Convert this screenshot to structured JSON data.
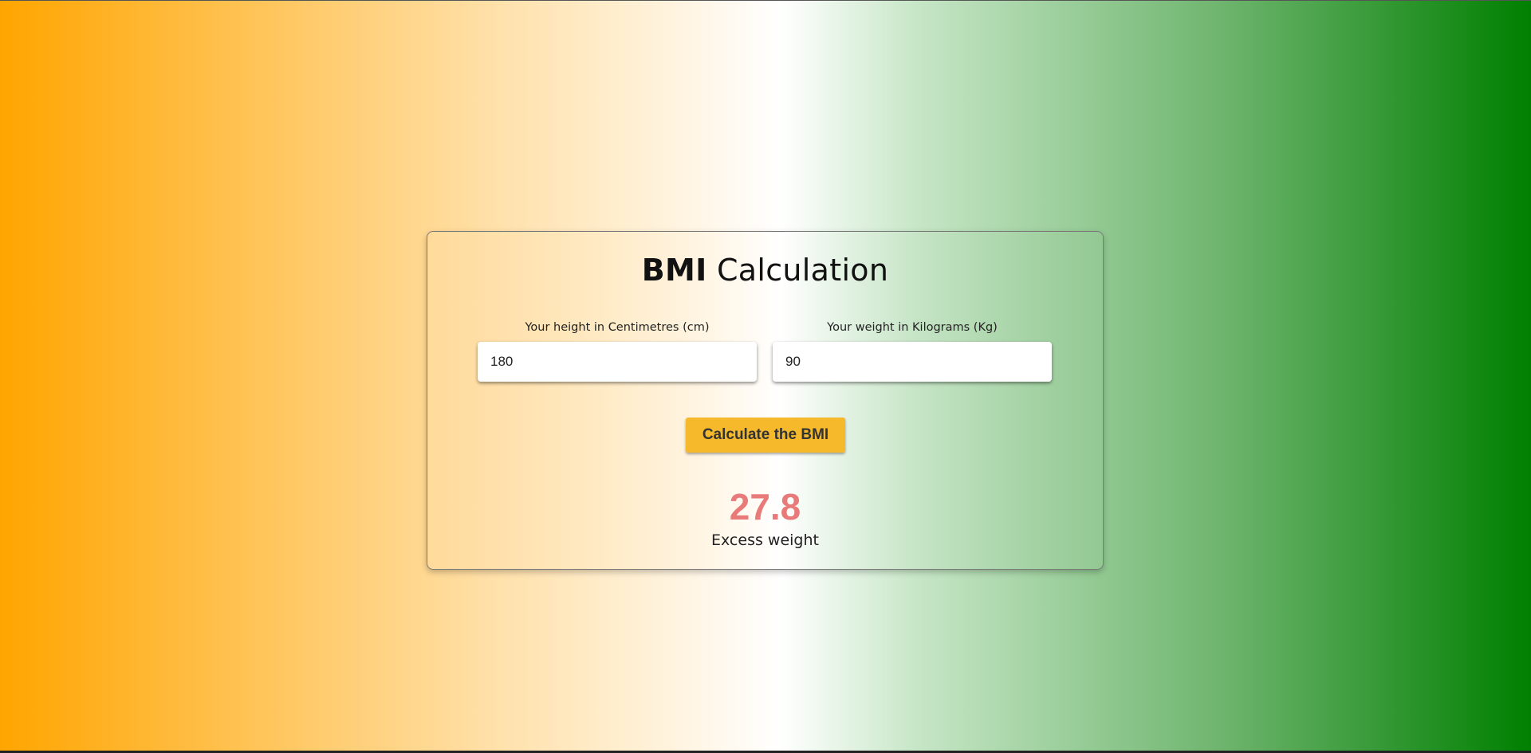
{
  "title": {
    "bold": "BMI",
    "light": "Calculation"
  },
  "height": {
    "label": "Your height in Centimetres (cm)",
    "value": "180"
  },
  "weight": {
    "label": "Your weight in Kilograms (Kg)",
    "value": "90"
  },
  "button": {
    "label": "Calculate the BMI"
  },
  "result": {
    "value": "27.8",
    "label": "Excess weight"
  },
  "colors": {
    "gradient_left": "#ffa500",
    "gradient_center": "#ffffff",
    "gradient_right": "#008000",
    "button": "#f6b92c",
    "result": "#e87a7a"
  }
}
